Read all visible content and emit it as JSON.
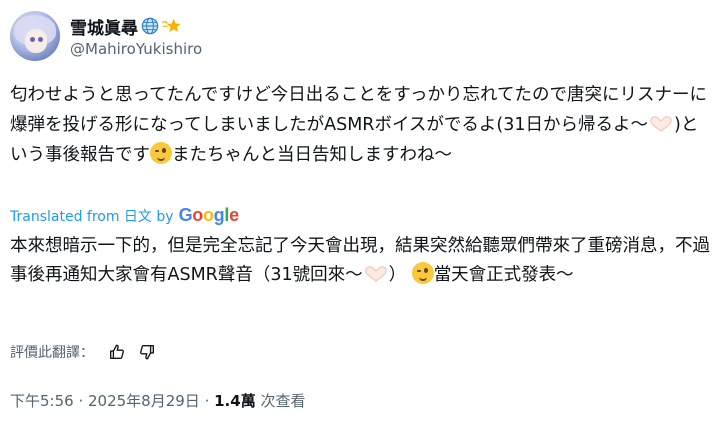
{
  "user": {
    "display_name": "雪城眞尋",
    "handle": "@MahiroYukishiro",
    "badges": [
      "globe-icon",
      "star-icon"
    ]
  },
  "tweet": {
    "original_part1": "匂わせようと思ってたんですけど今日出ることをすっかり忘れてたので唐突にリスナーに爆弾を投げる形になってしまいましたがASMRボイスがでるよ(31日から帰るよ〜",
    "original_part2": ")という事後報告です",
    "original_part3": "またちゃんと当日告知しますわね〜"
  },
  "translation": {
    "label": "Translated from 日文 by",
    "google": [
      "G",
      "o",
      "o",
      "g",
      "l",
      "e"
    ],
    "text_part1": "本來想暗示一下的，但是完全忘記了今天會出現，結果突然給聽眾們帶來了重磅消息，不過事後再通知大家會有ASMR聲音（31號回來～",
    "text_part2": "）",
    "text_part3": "當天會正式發表～"
  },
  "rating": {
    "label": "評價此翻譯："
  },
  "meta": {
    "time": "下午5:56",
    "sep1": " · ",
    "date": "2025年8月29日",
    "sep2": " · ",
    "views_count": "1.4萬",
    "views_label": " 次查看"
  }
}
